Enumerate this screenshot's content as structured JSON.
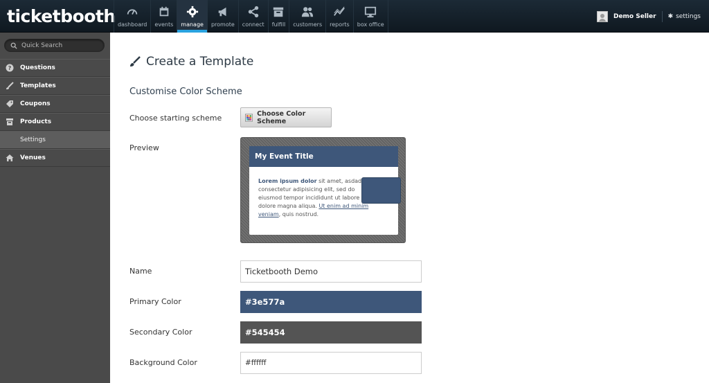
{
  "app": {
    "logo": "ticketbooth"
  },
  "nav": [
    {
      "label": "dashboard",
      "icon": "gauge-icon"
    },
    {
      "label": "events",
      "icon": "calendar-icon"
    },
    {
      "label": "manage",
      "icon": "gear-icon",
      "active": true
    },
    {
      "label": "promote",
      "icon": "megaphone-icon"
    },
    {
      "label": "connect",
      "icon": "share-icon"
    },
    {
      "label": "fulfill",
      "icon": "box-icon"
    },
    {
      "label": "customers",
      "icon": "users-icon"
    },
    {
      "label": "reports",
      "icon": "chart-line-icon"
    },
    {
      "label": "box office",
      "icon": "monitor-icon"
    }
  ],
  "user": {
    "name": "Demo Seller",
    "settings_label": "settings"
  },
  "sidebar": {
    "search_placeholder": "Quick Search",
    "items": [
      {
        "label": "Questions",
        "icon": "question-icon"
      },
      {
        "label": "Templates",
        "icon": "brush-icon"
      },
      {
        "label": "Coupons",
        "icon": "tag-icon"
      },
      {
        "label": "Products",
        "icon": "archive-icon"
      },
      {
        "label": "Settings",
        "sub": true
      },
      {
        "label": "Venues",
        "icon": "home-icon"
      }
    ]
  },
  "main": {
    "title": "Create a Template",
    "section_title": "Customise Color Scheme",
    "starting_scheme_label": "Choose starting scheme",
    "choose_scheme_button": "Choose Color Scheme",
    "preview_label": "Preview",
    "preview": {
      "event_title": "My Event Title",
      "lorem_bold": "Lorem ipsum dolor",
      "lorem_text": " sit amet, asdad consectetur adipisicing elit, sed do eiusmod tempor incididunt ut labore et dolore magna aliqua. ",
      "lorem_link": "Ut enim ad minim veniam",
      "lorem_end": ", quis nostrud."
    },
    "name_label": "Name",
    "name_value": "Ticketbooth Demo",
    "primary_label": "Primary Color",
    "primary_value": "#3e577a",
    "secondary_label": "Secondary Color",
    "secondary_value": "#545454",
    "background_label": "Background Color",
    "background_value": "#ffffff"
  },
  "colors": {
    "primary": "#3e577a",
    "secondary": "#545454",
    "accent": "#2aa3e0"
  }
}
